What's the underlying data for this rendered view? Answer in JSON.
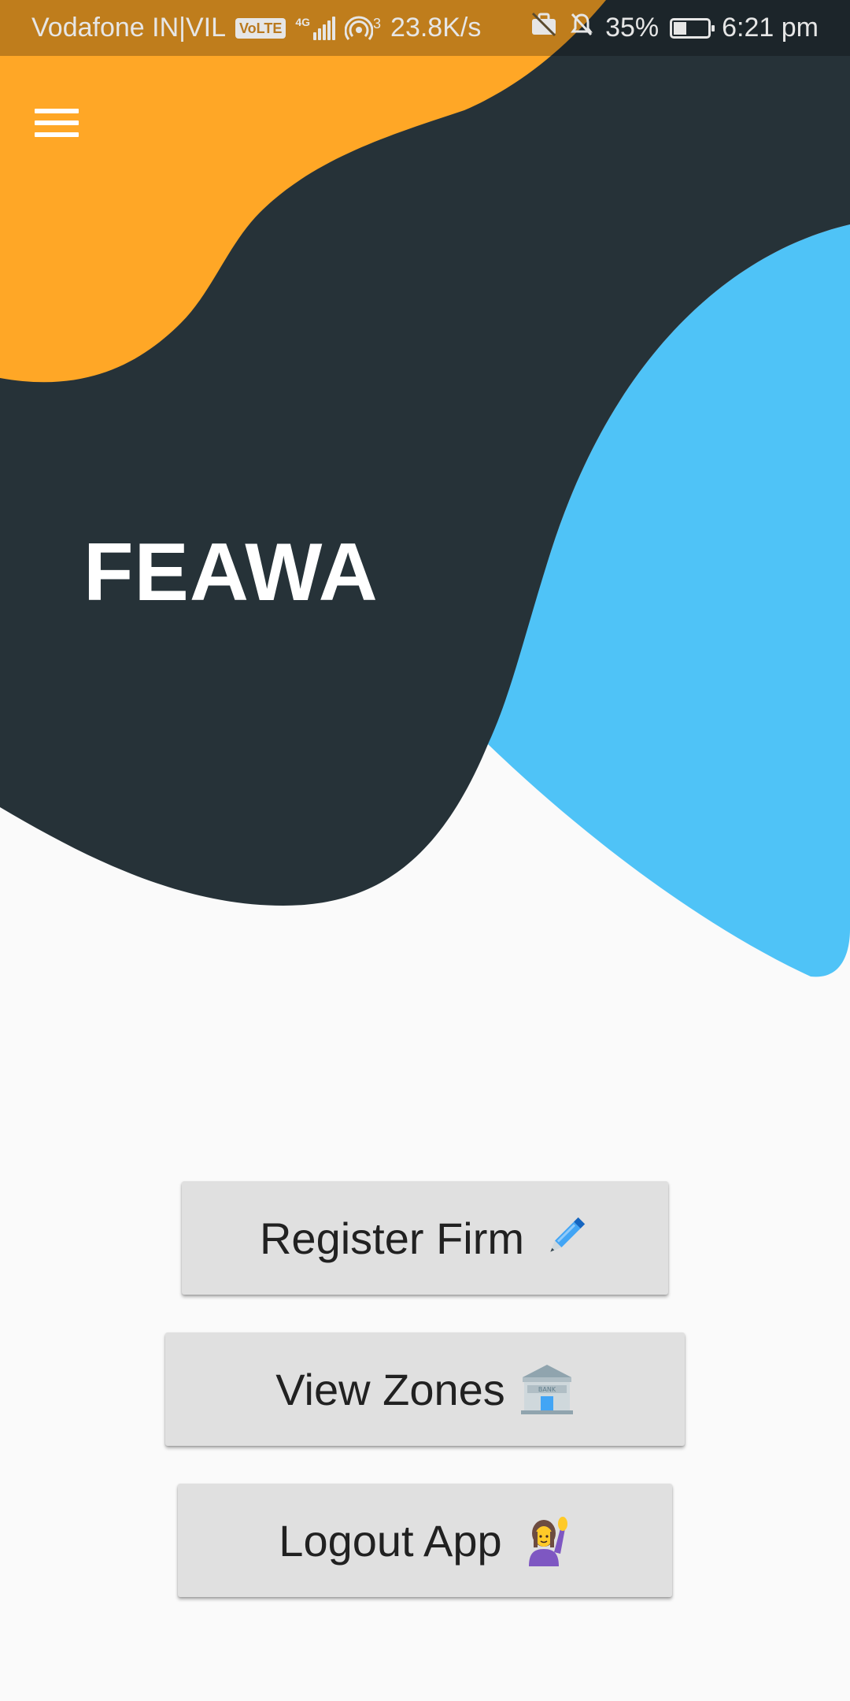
{
  "status_bar": {
    "carrier": "Vodafone IN|VIL",
    "volte": "VoLTE",
    "network_type": "4G",
    "hotspot_count": "3",
    "speed": "23.8K/s",
    "battery_percent": "35%",
    "time": "6:21 pm"
  },
  "header": {
    "menu_icon": "hamburger-menu-icon",
    "title": "FEAWA"
  },
  "actions": {
    "register_label": "Register Firm",
    "register_icon": "pen-icon",
    "zones_label": "View Zones",
    "zones_icon": "bank-icon",
    "logout_label": "Logout App",
    "logout_icon": "person-raising-hand-icon"
  },
  "colors": {
    "orange_blob": "#ffa726",
    "dark_blob": "#263238",
    "blue_blob": "#4fc3f7",
    "background": "#fafafa",
    "button": "#e0e0e0"
  }
}
